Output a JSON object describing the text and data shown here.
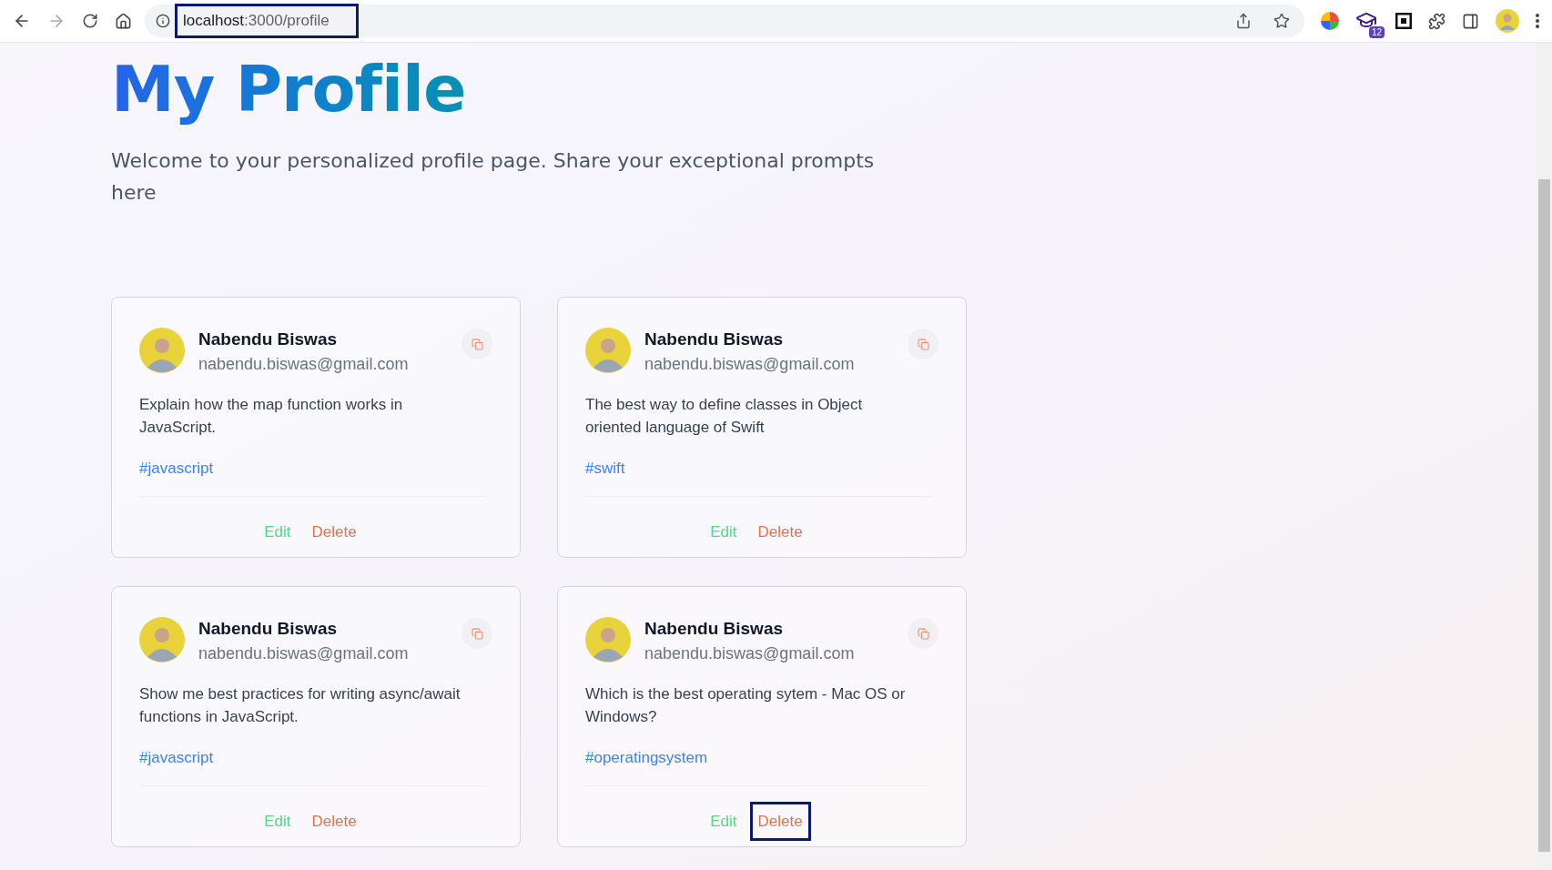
{
  "browser": {
    "url_host": "localhost",
    "url_path": ":3000/profile",
    "url_focused": true,
    "extension_badge": "12"
  },
  "page": {
    "title": "My Profile",
    "description": "Welcome to your personalized profile page. Share your exceptional prompts here"
  },
  "posts": [
    {
      "name": "Nabendu Biswas",
      "email": "nabendu.biswas@gmail.com",
      "prompt": "Explain how the map function works in JavaScript.",
      "tag": "#javascript",
      "edit": "Edit",
      "delete": "Delete",
      "delete_focused": false
    },
    {
      "name": "Nabendu Biswas",
      "email": "nabendu.biswas@gmail.com",
      "prompt": "The best way to define classes in Object oriented language of Swift",
      "tag": "#swift",
      "edit": "Edit",
      "delete": "Delete",
      "delete_focused": false
    },
    {
      "name": "Nabendu Biswas",
      "email": "nabendu.biswas@gmail.com",
      "prompt": "Show me best practices for writing async/await functions in JavaScript.",
      "tag": "#javascript",
      "edit": "Edit",
      "delete": "Delete",
      "delete_focused": false
    },
    {
      "name": "Nabendu Biswas",
      "email": "nabendu.biswas@gmail.com",
      "prompt": "Which is the best operating sytem - Mac OS or Windows?",
      "tag": "#operatingsystem",
      "edit": "Edit",
      "delete": "Delete",
      "delete_focused": true
    }
  ]
}
